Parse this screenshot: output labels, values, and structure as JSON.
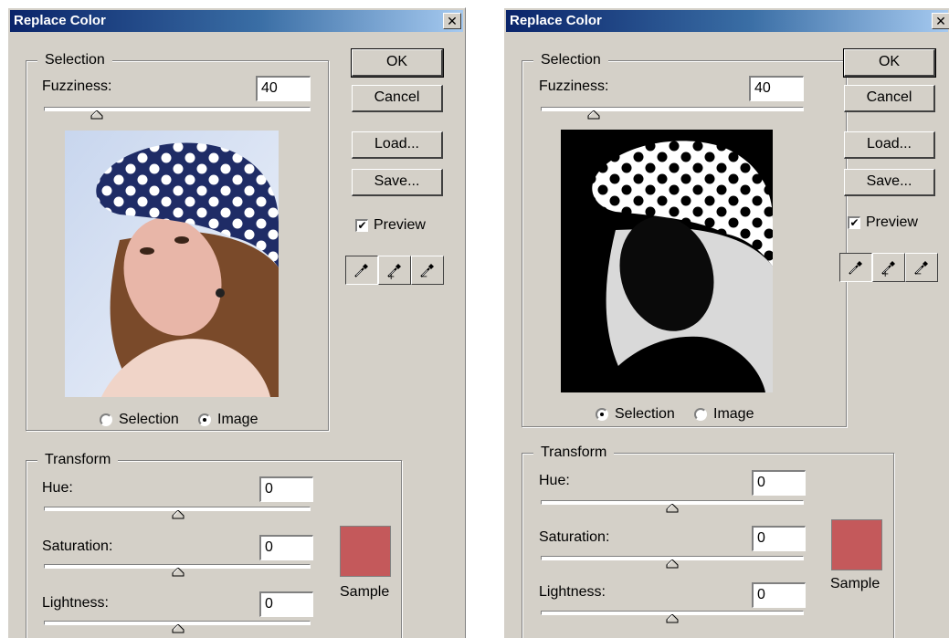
{
  "colors": {
    "sample": "#c4595b",
    "hat_navy": "#1f2c66",
    "skin": "#e8b6a8",
    "hair": "#7a4a2a"
  },
  "dialogs": [
    {
      "title": "Replace Color",
      "close_label": "✕",
      "selection": {
        "legend": "Selection",
        "fuzziness_label": "Fuzziness:",
        "fuzziness_value": "40",
        "view_options": [
          "Selection",
          "Image"
        ],
        "view_selected": "Image"
      },
      "buttons": {
        "ok": "OK",
        "cancel": "Cancel",
        "load": "Load...",
        "save": "Save..."
      },
      "preview_label": "Preview",
      "preview_checked": true,
      "transform": {
        "legend": "Transform",
        "hue_label": "Hue:",
        "hue_value": "0",
        "saturation_label": "Saturation:",
        "saturation_value": "0",
        "lightness_label": "Lightness:",
        "lightness_value": "0",
        "sample_label": "Sample"
      }
    },
    {
      "title": "Replace Color",
      "close_label": "✕",
      "selection": {
        "legend": "Selection",
        "fuzziness_label": "Fuzziness:",
        "fuzziness_value": "40",
        "view_options": [
          "Selection",
          "Image"
        ],
        "view_selected": "Selection"
      },
      "buttons": {
        "ok": "OK",
        "cancel": "Cancel",
        "load": "Load...",
        "save": "Save..."
      },
      "preview_label": "Preview",
      "preview_checked": true,
      "transform": {
        "legend": "Transform",
        "hue_label": "Hue:",
        "hue_value": "0",
        "saturation_label": "Saturation:",
        "saturation_value": "0",
        "lightness_label": "Lightness:",
        "lightness_value": "0",
        "sample_label": "Sample"
      }
    }
  ]
}
